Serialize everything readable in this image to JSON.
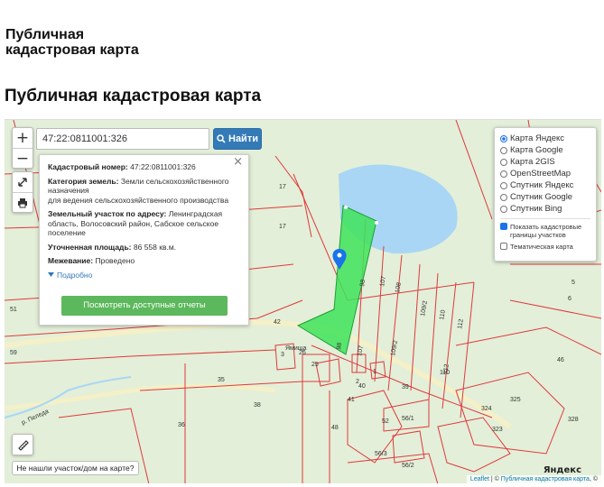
{
  "site": {
    "title_line1": "Публичная",
    "title_line2": "кадастровая карта"
  },
  "page": {
    "heading": "Публичная кадастровая карта"
  },
  "map": {
    "zoom_in": "+",
    "zoom_out": "−",
    "search": {
      "value": "47:22:0811001:326",
      "button_label": "Найти",
      "button_icon": "search-icon"
    },
    "info": {
      "close": "×",
      "cadastral_number_label": "Кадастровый номер:",
      "cadastral_number_value": "47:22:0811001:326",
      "land_category_label": "Категория земель:",
      "land_category_value": "Земли сельскохозяйственного назначения",
      "land_use": "для ведения сельскохозяйственного производства",
      "address_label": "Земельный участок по адресу:",
      "address_value": "Ленинградская область, Волосовский район, Сабское сельское поселение",
      "area_label": "Уточненная площадь:",
      "area_value": "86 558 кв.м.",
      "survey_label": "Межевание:",
      "survey_value": "Проведено",
      "more_link": "Подробно",
      "report_button": "Посмотреть доступные отчеты"
    },
    "layers": {
      "base": [
        {
          "label": "Карта Яндекс",
          "selected": true
        },
        {
          "label": "Карта Google",
          "selected": false
        },
        {
          "label": "Карта 2GIS",
          "selected": false
        },
        {
          "label": "OpenStreetMap",
          "selected": false
        },
        {
          "label": "Спутник Яндекс",
          "selected": false
        },
        {
          "label": "Спутник Google",
          "selected": false
        },
        {
          "label": "Спутник Bing",
          "selected": false
        }
      ],
      "overlays": [
        {
          "label": "Показать кадастровые границы участков",
          "checked": true
        },
        {
          "label": "Тематическая карта",
          "checked": false
        }
      ]
    },
    "not_found_button": "Не нашли участок/дом на карте?",
    "attribution": {
      "leaflet": "Leaflet",
      "sep": " | © ",
      "pkk": "Публичная кадастровая карта",
      "suffix": ", ©"
    },
    "yandex_logo": "Яндекс",
    "place_labels": {
      "village": "Ямища",
      "river": "р. Пеледа"
    },
    "plot_numbers": [
      "17",
      "17",
      "51",
      "42",
      "59",
      "98",
      "98",
      "107",
      "107",
      "108",
      "109/2",
      "109/2",
      "110",
      "112",
      "112",
      "110",
      "35",
      "36",
      "38",
      "48",
      "41",
      "40",
      "39",
      "26",
      "25",
      "2",
      "3",
      "1",
      "52",
      "56/1",
      "56/2",
      "56/3",
      "325",
      "324",
      "323",
      "328",
      "5",
      "46",
      "6"
    ],
    "colors": {
      "selected_plot": "#3fe35a",
      "boundary": "#e0393e",
      "water": "#a9d6f5",
      "land": "#e3efd8",
      "accent": "#337ab7",
      "report": "#5cb85c"
    }
  }
}
